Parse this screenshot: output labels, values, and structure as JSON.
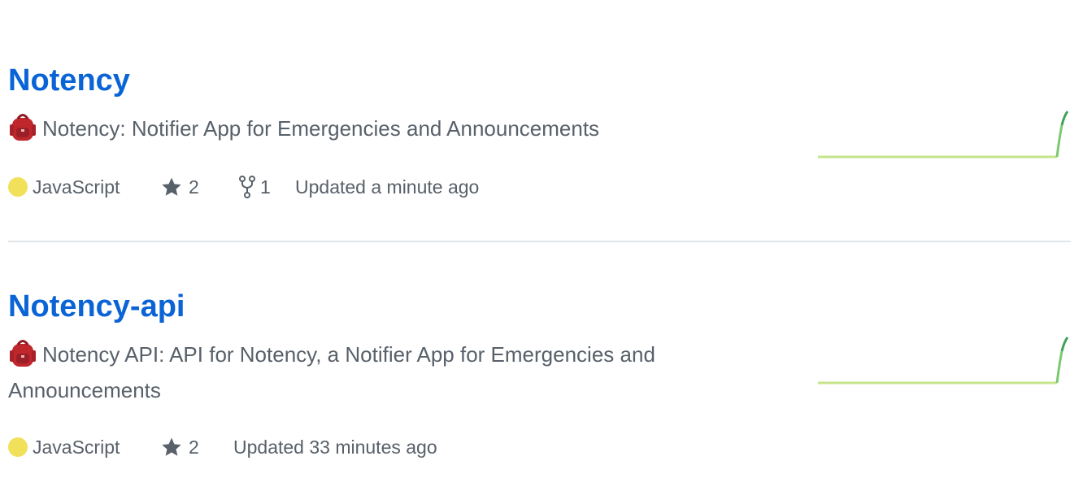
{
  "repos": [
    {
      "name": "Notency",
      "description_emoji": "backpack-icon",
      "description": "Notency: Notifier App for Emergencies and Announcements",
      "language": "JavaScript",
      "language_color": "#f1e05a",
      "stars": "2",
      "forks": "1",
      "updated": "Updated a minute ago"
    },
    {
      "name": "Notency-api",
      "description_emoji": "backpack-icon",
      "description": "Notency API: API for Notency, a Notifier App for Emergencies and Announcements",
      "language": "JavaScript",
      "language_color": "#f1e05a",
      "stars": "2",
      "updated": "Updated 33 minutes ago"
    }
  ],
  "colors": {
    "title": "#0a64d6",
    "muted": "#586069",
    "divider": "#e1e4e8",
    "sparkline_light": "#c6e48b",
    "sparkline_dark": "#40a05a"
  }
}
